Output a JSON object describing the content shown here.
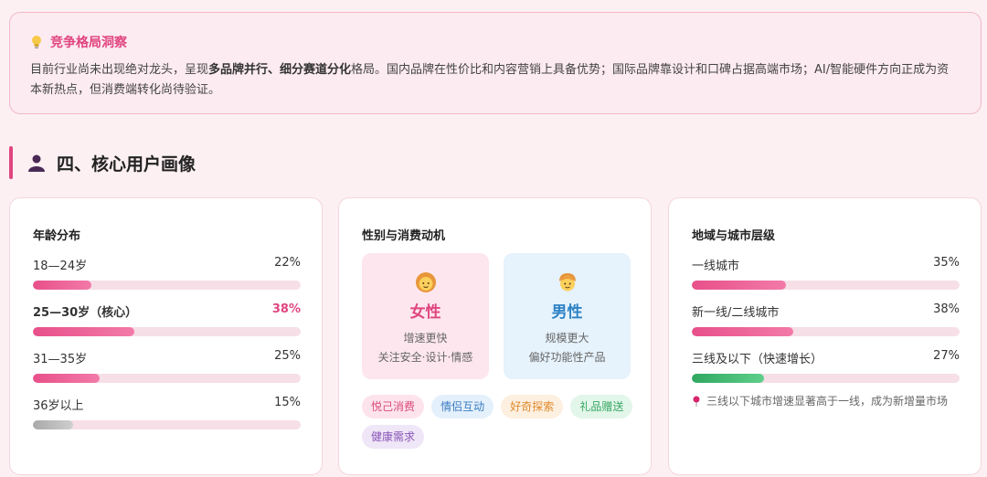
{
  "insight": {
    "title": "竞争格局洞察",
    "text_before": "目前行业尚未出现绝对龙头，呈现",
    "text_bold": "多品牌并行、细分赛道分化",
    "text_after": "格局。国内品牌在性价比和内容营销上具备优势；国际品牌靠设计和口碑占据高端市场；AI/智能硬件方向正成为资本新热点，但消费端转化尚待验证。",
    "icon": "lightbulb-icon"
  },
  "section": {
    "title": "四、核心用户画像",
    "icon": "person-icon"
  },
  "age": {
    "title": "年龄分布",
    "rows": [
      {
        "label": "18—24岁",
        "pct": "22%",
        "value": 22
      },
      {
        "label": "25—30岁（核心）",
        "pct": "38%",
        "value": 38
      },
      {
        "label": "31—35岁",
        "pct": "25%",
        "value": 25
      },
      {
        "label": "36岁以上",
        "pct": "15%",
        "value": 15
      }
    ]
  },
  "gender": {
    "title": "性别与消费动机",
    "female": {
      "label": "女性",
      "line1": "增速更快",
      "line2": "关注安全·设计·情感"
    },
    "male": {
      "label": "男性",
      "line1": "规模更大",
      "line2": "偏好功能性产品"
    },
    "tags": [
      "悦己消费",
      "情侣互动",
      "好奇探索",
      "礼品赠送",
      "健康需求"
    ]
  },
  "region": {
    "title": "地域与城市层级",
    "rows": [
      {
        "label": "一线城市",
        "pct": "35%",
        "value": 35
      },
      {
        "label": "新一线/二线城市",
        "pct": "38%",
        "value": 38
      },
      {
        "label": "三线及以下（快速增长）",
        "pct": "27%",
        "value": 27
      }
    ],
    "note": "三线以下城市增速显著高于一线，成为新增量市场"
  },
  "colors": {
    "accent": "#e0457f",
    "male": "#2d83c6",
    "growth": "#2fa861"
  }
}
